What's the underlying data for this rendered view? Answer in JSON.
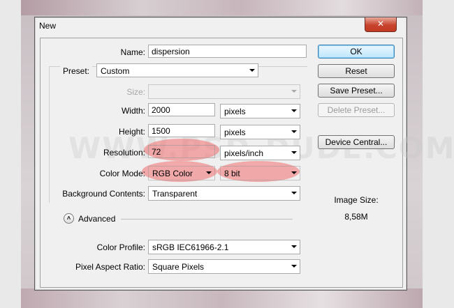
{
  "window": {
    "title": "New",
    "close_icon": "close-icon"
  },
  "watermark": "WWW.PSD-DUDE.COM",
  "fields": {
    "name": {
      "label": "Name:",
      "value": "dispersion"
    },
    "preset": {
      "label": "Preset:",
      "value": "Custom"
    },
    "size": {
      "label": "Size:",
      "value": ""
    },
    "width": {
      "label": "Width:",
      "value": "2000",
      "unit": "pixels"
    },
    "height": {
      "label": "Height:",
      "value": "1500",
      "unit": "pixels"
    },
    "resolution": {
      "label": "Resolution:",
      "value": "72",
      "unit": "pixels/inch"
    },
    "color_mode": {
      "label": "Color Mode:",
      "value": "RGB Color",
      "depth": "8 bit"
    },
    "background": {
      "label": "Background Contents:",
      "value": "Transparent"
    },
    "advanced": {
      "label": "Advanced"
    },
    "color_profile": {
      "label": "Color Profile:",
      "value": "sRGB IEC61966-2.1"
    },
    "pixel_aspect": {
      "label": "Pixel Aspect Ratio:",
      "value": "Square Pixels"
    }
  },
  "buttons": {
    "ok": "OK",
    "reset": "Reset",
    "save_preset": "Save Preset...",
    "delete_preset": "Delete Preset...",
    "device_central": "Device Central..."
  },
  "image_size": {
    "label": "Image Size:",
    "value": "8,58M"
  },
  "colors": {
    "highlight": "#f06e6e",
    "ok_accent": "#3c7fb1",
    "close_red": "#c8442d"
  }
}
